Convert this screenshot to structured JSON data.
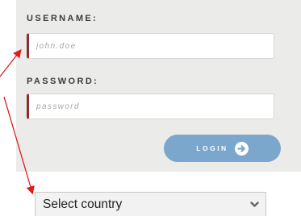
{
  "login_form": {
    "username_label": "USERNAME:",
    "username_placeholder": "john.doe",
    "password_label": "PASSWORD:",
    "password_placeholder": "password",
    "login_label": "LOGIN"
  },
  "country_select": {
    "selected": "Select country"
  },
  "colors": {
    "panel_background": "#ebebea",
    "input_accent": "#8a2e2e",
    "login_button": "#7ca7cd",
    "annotation_arrow": "#e01b1b"
  },
  "icons": {
    "login_arrow": "arrow-right-circle-icon",
    "select_chevron": "chevron-down-icon"
  }
}
